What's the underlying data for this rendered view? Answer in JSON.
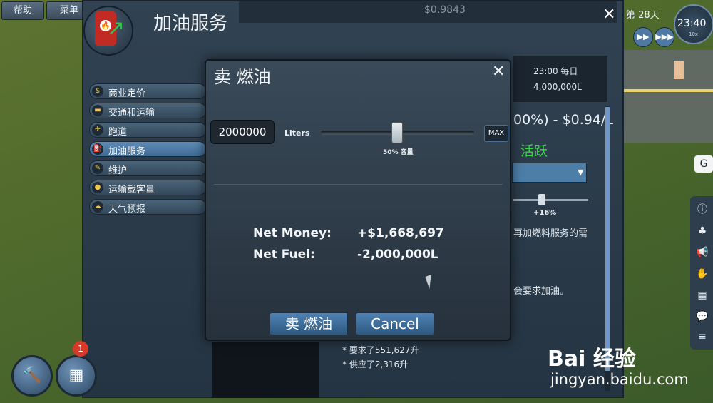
{
  "top_buttons": {
    "help": "帮助",
    "menu": "菜单"
  },
  "window": {
    "title": "加油服务"
  },
  "statbar": {
    "s1": "$0.9843"
  },
  "sidebar": {
    "items": [
      {
        "label": "商业定价",
        "icon": "coin-icon",
        "active": false
      },
      {
        "label": "交通和运输",
        "icon": "car-icon",
        "active": false
      },
      {
        "label": "跑道",
        "icon": "runway-icon",
        "active": false
      },
      {
        "label": "加油服务",
        "icon": "fuel-icon",
        "active": true
      },
      {
        "label": "维护",
        "icon": "wrench-icon",
        "active": false
      },
      {
        "label": "运输载客量",
        "icon": "capacity-icon",
        "active": false
      },
      {
        "label": "天气预报",
        "icon": "cloud-icon",
        "active": false
      }
    ]
  },
  "info_panel": {
    "time_label": "23:00 每日",
    "capacity": "4,000,000L",
    "price_text": "00%) - $0.94/L",
    "status": "活跃",
    "slider_pct": "+16%",
    "note1": "再加燃料服务的需",
    "note2": "会要求加油。",
    "bullet1": "* 要求了551,627升",
    "bullet2": "* 供应了2,316升"
  },
  "clock": {
    "day": "第 28天",
    "time": "23:40",
    "speed": "10x"
  },
  "right_toolbar": {
    "g": "G"
  },
  "dialog": {
    "title": "卖 燃油",
    "liters_value": "2000000",
    "liters_label": "Liters",
    "slider_caption": "50% 容量",
    "slider_fraction": 0.5,
    "max_label": "MAX",
    "net_money_label": "Net Money:",
    "net_money_value": "+$1,668,697",
    "net_fuel_label": "Net Fuel:",
    "net_fuel_value": "-2,000,000L",
    "confirm_label": "卖 燃油",
    "cancel_label": "Cancel"
  },
  "badge": "1",
  "watermark": {
    "logo": "Bai 经验",
    "url": "jingyan.baidu.com"
  },
  "colors": {
    "accent": "#4f83b4",
    "active_green": "#3bd24b",
    "fuel_red": "#c22b24"
  }
}
